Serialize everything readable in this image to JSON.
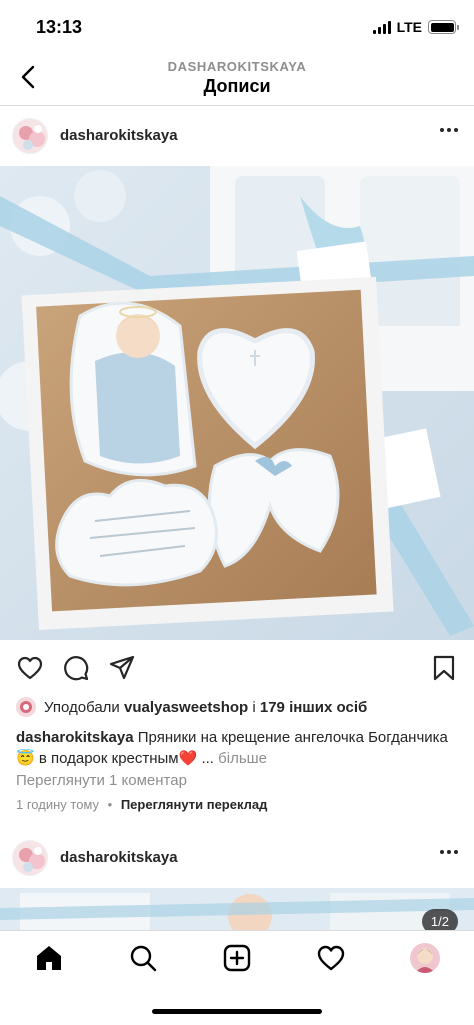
{
  "status_bar": {
    "time": "13:13",
    "network": "LTE",
    "signal_bars": 4,
    "battery_level": 1.0
  },
  "header": {
    "account": "DASHAROKITSKAYA",
    "title": "Дописи"
  },
  "post": {
    "username": "dasharokitskaya",
    "likes": {
      "prefix": "Уподобали ",
      "user": "vualyasweetshop",
      "middle": " і ",
      "count": "179 інших осіб"
    },
    "caption": {
      "username": "dasharokitskaya",
      "text": " Пряники на крещение ангелочка Богданчика😇 в подарок крестным❤️ ... ",
      "more": "більше"
    },
    "comments_link": "Переглянути 1 коментар",
    "timestamp": "1 годину тому",
    "separator": "•",
    "translate": "Переглянути переклад"
  },
  "next_post": {
    "username": "dasharokitskaya",
    "page_counter": "1/2"
  },
  "icons": {
    "back": "chevron-left-icon",
    "like": "heart-icon",
    "comment": "comment-icon",
    "share": "paper-plane-icon",
    "save": "bookmark-icon",
    "home": "home-icon",
    "search": "search-icon",
    "new_post": "plus-square-icon",
    "activity": "heart-icon",
    "profile": "avatar"
  }
}
